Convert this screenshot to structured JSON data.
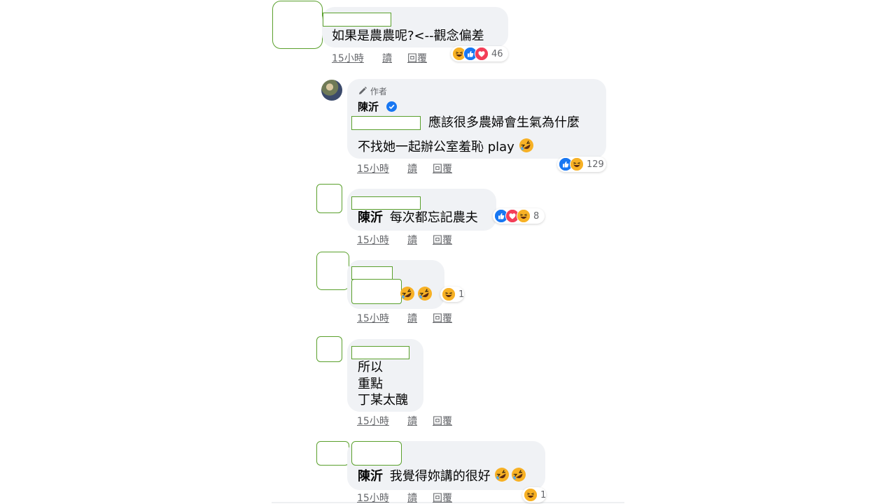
{
  "reaction_colors": {
    "like": "#1877f2",
    "love": "#f33e58",
    "haha": "#f7b125"
  },
  "meta_labels": {
    "read": "讀",
    "reply": "回覆"
  },
  "comments": [
    {
      "text": "如果是農農呢?<--觀念偏差",
      "time": "15小時",
      "reactions": [
        "haha",
        "like",
        "love"
      ],
      "reaction_count": "46"
    },
    {
      "author_badge_icon": "pencil-icon",
      "author_badge": "作者",
      "author": "陳沂",
      "verified_icon": "verified-badge-icon",
      "text_line1": "應該很多農婦會生氣為什麼",
      "text_line2": "不找她一起辦公室羞恥 play",
      "emoji": "rolling-laugh-emoji",
      "time": "15小時",
      "reactions": [
        "like",
        "haha"
      ],
      "reaction_count": "129"
    },
    {
      "mention": "陳沂",
      "text": "每次都忘記農夫",
      "time": "15小時",
      "reactions": [
        "like",
        "love",
        "haha"
      ],
      "reaction_count": "8"
    },
    {
      "emoji": "rolling-laugh-emoji",
      "time": "15小時",
      "reactions": [
        "haha"
      ],
      "reaction_count": "1"
    },
    {
      "lines": [
        "所以",
        "重點",
        "丁某太醜"
      ],
      "time": "15小時"
    },
    {
      "mention": "陳沂",
      "text": "我覺得妳講的很好",
      "emoji": "rolling-laugh-emoji",
      "time": "15小時",
      "reactions": [
        "haha"
      ],
      "reaction_count": "1"
    }
  ]
}
